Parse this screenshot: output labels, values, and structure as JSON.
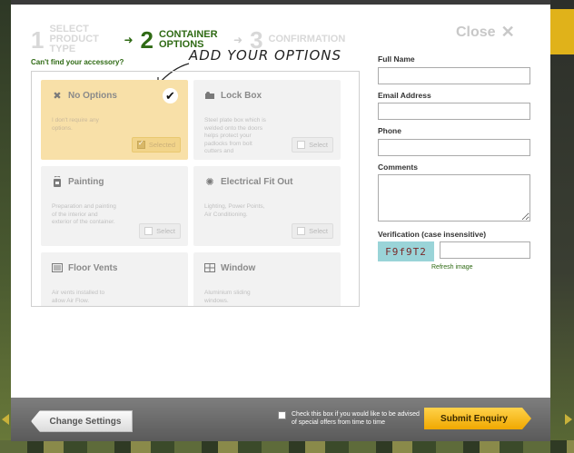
{
  "steps": [
    {
      "num": "1",
      "label": "SELECT PRODUCT TYPE",
      "state": "done"
    },
    {
      "num": "2",
      "label": "CONTAINER OPTIONS",
      "state": "active"
    },
    {
      "num": "3",
      "label": "CONFIRMATION",
      "state": "upcoming"
    }
  ],
  "close_label": "Close",
  "cant_find": "Can't find your accessory?",
  "annotation": "ADD YOUR OPTIONS",
  "options": [
    {
      "title": "No Options",
      "icon": "x-icon",
      "desc": "I don't require any options.",
      "button": "Selected",
      "selected": true
    },
    {
      "title": "Lock Box",
      "icon": "lock-box-icon",
      "desc": "Steel plate box which is welded onto the doors helps protect your padlocks from bolt cutters and",
      "button": "Select",
      "selected": false
    },
    {
      "title": "Painting",
      "icon": "paint-can-icon",
      "desc": "Preparation and painting of the interior and exterior of the container.",
      "button": "Select",
      "selected": false
    },
    {
      "title": "Electrical Fit Out",
      "icon": "electrical-icon",
      "desc": "Lighting, Power Points, Air Conditioning.",
      "button": "Select",
      "selected": false
    },
    {
      "title": "Floor Vents",
      "icon": "floor-vent-icon",
      "desc": "Air vents installed to allow Air Flow.",
      "button": "",
      "selected": false
    },
    {
      "title": "Window",
      "icon": "window-icon",
      "desc": "Aluminium sliding windows.",
      "button": "",
      "selected": false
    }
  ],
  "form": {
    "full_name_label": "Full Name",
    "full_name_value": "",
    "email_label": "Email Address",
    "email_value": "",
    "phone_label": "Phone",
    "phone_value": "",
    "comments_label": "Comments",
    "comments_value": "",
    "verification_label": "Verification (case insensitive)",
    "captcha_text": "F9f9T2",
    "verification_value": "",
    "refresh_label": "Refresh image"
  },
  "footer": {
    "change_settings_label": "Change Settings",
    "offers_text": "Check this box if you would like to be advised of special offers from time to time",
    "offers_checked": false,
    "submit_label": "Submit Enquiry"
  },
  "colors": {
    "accent_green": "#2f6a14",
    "selected_bg": "#f8e0a8",
    "submit_yellow": "#f5b800"
  }
}
